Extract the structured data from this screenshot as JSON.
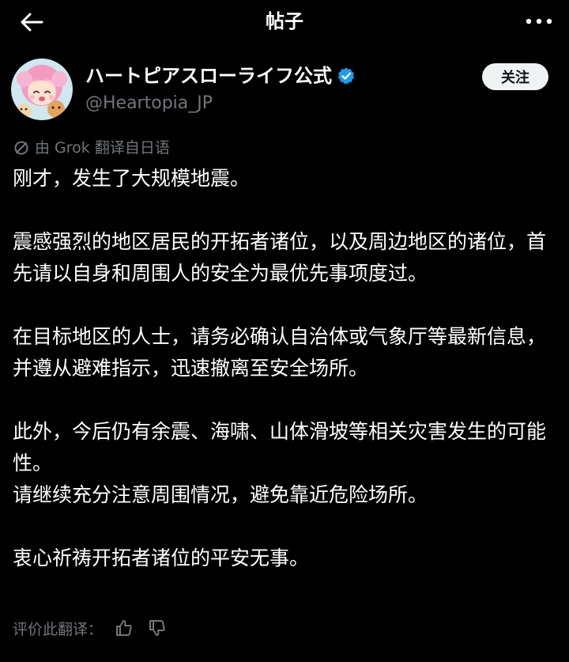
{
  "header": {
    "title": "帖子",
    "back_icon": "arrow-left-icon",
    "more_icon": "more-horizontal-icon"
  },
  "author": {
    "display_name": "ハートピアスローライフ公式",
    "handle": "@Heartopia_JP",
    "verified_icon": "verified-badge-icon",
    "verified_color": "#1d9bf0",
    "follow_label": "关注"
  },
  "translation_note": {
    "icon": "translate-icon",
    "text": "由 Grok 翻译自日语"
  },
  "post": {
    "paragraphs": [
      "刚才，发生了大规模地震。",
      "震感强烈的地区居民的开拓者诸位，以及周边地区的诸位，首先请以自身和周围人的安全为最优先事项度过。",
      "在目标地区的人士，请务必确认自治体或气象厅等最新信息，并遵从避难指示，迅速撤离至安全场所。",
      "此外，今后仍有余震、海啸、山体滑坡等相关灾害发生的可能性。",
      "请继续充分注意周围情况，避免靠近危险场所。",
      "衷心祈祷开拓者诸位的平安无事。"
    ]
  },
  "rating": {
    "label": "评价此翻译：",
    "thumbs_up_icon": "thumbs-up-icon",
    "thumbs_down_icon": "thumbs-down-icon"
  },
  "colors": {
    "background": "#000000",
    "text": "#ffffff",
    "muted": "#71767b",
    "follow_bg": "#eff3f4"
  }
}
